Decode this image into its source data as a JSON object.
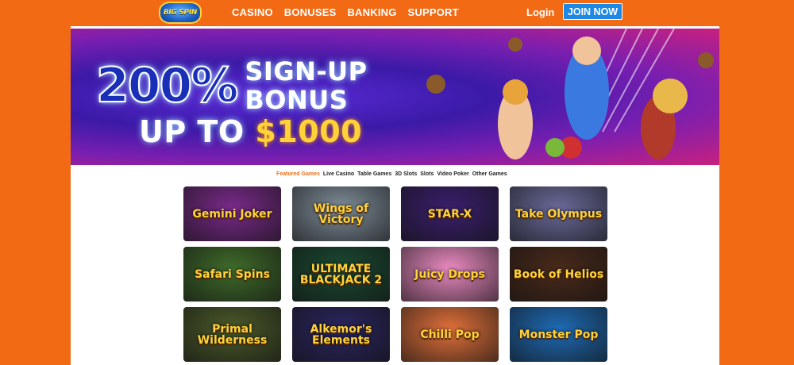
{
  "header": {
    "logo_text": "BIG SPIN",
    "nav": [
      "CASINO",
      "BONUSES",
      "BANKING",
      "SUPPORT"
    ],
    "login": "Login",
    "join": "JOIN NOW"
  },
  "banner": {
    "percent": "200%",
    "line1a": "SIGN-UP",
    "line1b": "BONUS",
    "line2a": "UP TO",
    "line2b": "$1000"
  },
  "tabs": [
    "Featured Games",
    "Live Casino",
    "Table Games",
    "3D Slots",
    "Slots",
    "Video Poker",
    "Other Games"
  ],
  "games": [
    {
      "title": "Gemini Joker",
      "bg": "#7a2a8a"
    },
    {
      "title": "Wings of Victory",
      "bg": "#7f8d99"
    },
    {
      "title": "STAR-X",
      "bg": "#3a1f6d"
    },
    {
      "title": "Take Olympus",
      "bg": "#6a6a9a"
    },
    {
      "title": "Safari Spins",
      "bg": "#3f6b2a"
    },
    {
      "title": "ULTIMATE BLACKJACK 2",
      "bg": "#1a4a33"
    },
    {
      "title": "Juicy Drops",
      "bg": "#e98ac0"
    },
    {
      "title": "Book of Helios",
      "bg": "#4a2a1a"
    },
    {
      "title": "Primal Wilderness",
      "bg": "#4b5a2a"
    },
    {
      "title": "Alkemor's Elements",
      "bg": "#2a2560"
    },
    {
      "title": "Chilli Pop",
      "bg": "#e0703a"
    },
    {
      "title": "Monster Pop",
      "bg": "#1e6bb5"
    }
  ]
}
